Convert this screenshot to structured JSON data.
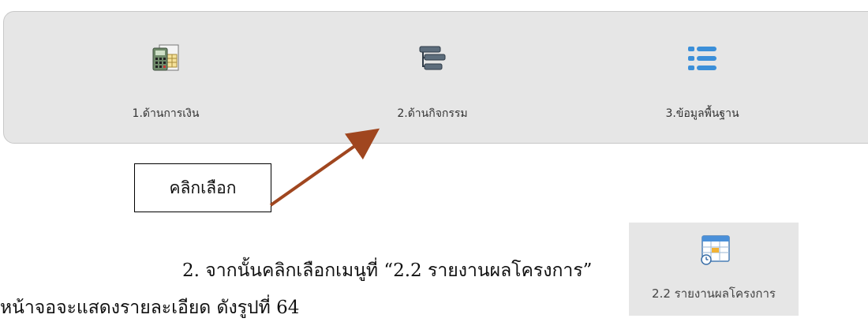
{
  "page_fragment_top": "ู",
  "menu": {
    "items": [
      {
        "label": "1.ด้านการเงิน",
        "icon": "finance-calculator-icon"
      },
      {
        "label": "2.ด้านกิจกรรม",
        "icon": "activity-tree-icon"
      },
      {
        "label": "3.ข้อมูลพื้นฐาน",
        "icon": "list-icon"
      }
    ]
  },
  "callout": {
    "text": "คลิกเลือก"
  },
  "instructions": {
    "step2": "2.  จากนั้นคลิกเลือกเมนูที่ “2.2 รายงานผลโครงการ”",
    "continuation": "หน้าจอจะแสดงรายละเอียด ดังรูปที่ 64"
  },
  "submenu": {
    "label": "2.2 รายงานผลโครงการ",
    "icon": "calendar-report-icon"
  },
  "colors": {
    "arrow": "#a0461f",
    "panel_bg": "#e6e6e6"
  }
}
